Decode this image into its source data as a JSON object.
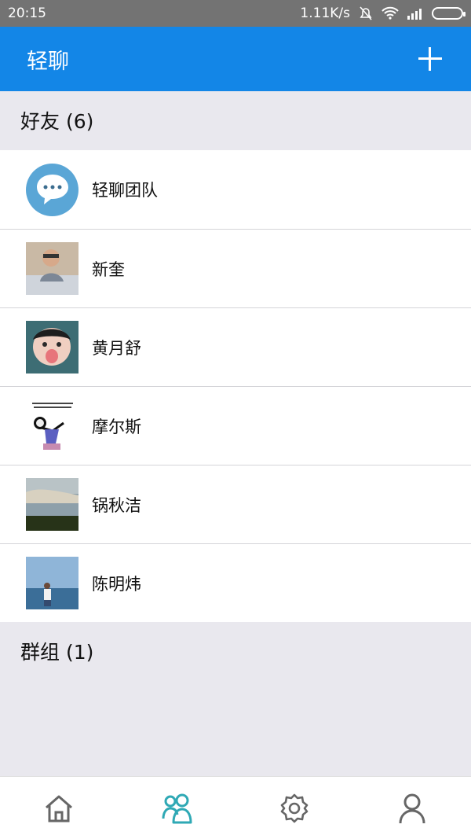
{
  "status_bar": {
    "time": "20:15",
    "speed": "1.11K/s",
    "icons": [
      "bell-off-icon",
      "wifi-icon",
      "signal-icon",
      "battery-icon"
    ]
  },
  "app_bar": {
    "title": "轻聊",
    "add_icon": "plus-icon"
  },
  "friends": {
    "header": "好友 (6)",
    "items": [
      {
        "name": "轻聊团队",
        "avatar": "chat-bubble-icon"
      },
      {
        "name": "新奎",
        "avatar": "photo"
      },
      {
        "name": "黄月舒",
        "avatar": "photo"
      },
      {
        "name": "摩尔斯",
        "avatar": "photo"
      },
      {
        "name": "锅秋洁",
        "avatar": "photo"
      },
      {
        "name": "陈明炜",
        "avatar": "photo"
      }
    ]
  },
  "groups": {
    "header": "群组 (1)"
  },
  "tabs": [
    {
      "icon": "home-icon"
    },
    {
      "icon": "contacts-icon",
      "active": true
    },
    {
      "icon": "settings-icon"
    },
    {
      "icon": "profile-icon"
    }
  ],
  "colors": {
    "primary": "#1386e7",
    "active_tab": "#2fa9b5",
    "inactive_tab": "#666666"
  }
}
